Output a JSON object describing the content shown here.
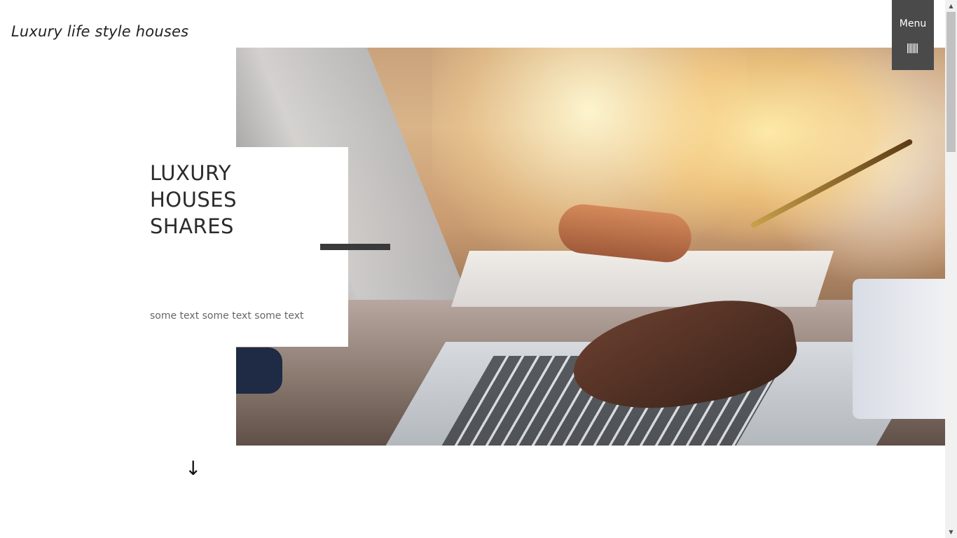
{
  "header": {
    "site_title": "Luxury life style houses",
    "menu_label": "Menu",
    "menu_icon": "barcode-menu-icon"
  },
  "hero": {
    "headline_lines": [
      "LUXURY",
      "HOUSES",
      "SHARES"
    ],
    "subtext": "some text some text some text",
    "image_subject": "laptop-business-meeting-photo"
  },
  "scroll_down": {
    "glyph": "↓",
    "icon": "arrow-down-icon"
  },
  "scrollbar": {
    "up_glyph": "▲",
    "down_glyph": "▼"
  },
  "colors": {
    "menu_bg": "#4a4a4a",
    "accent_bar": "#3a3a3a",
    "text_dark": "#2b2b2b",
    "text_muted": "#666666"
  }
}
